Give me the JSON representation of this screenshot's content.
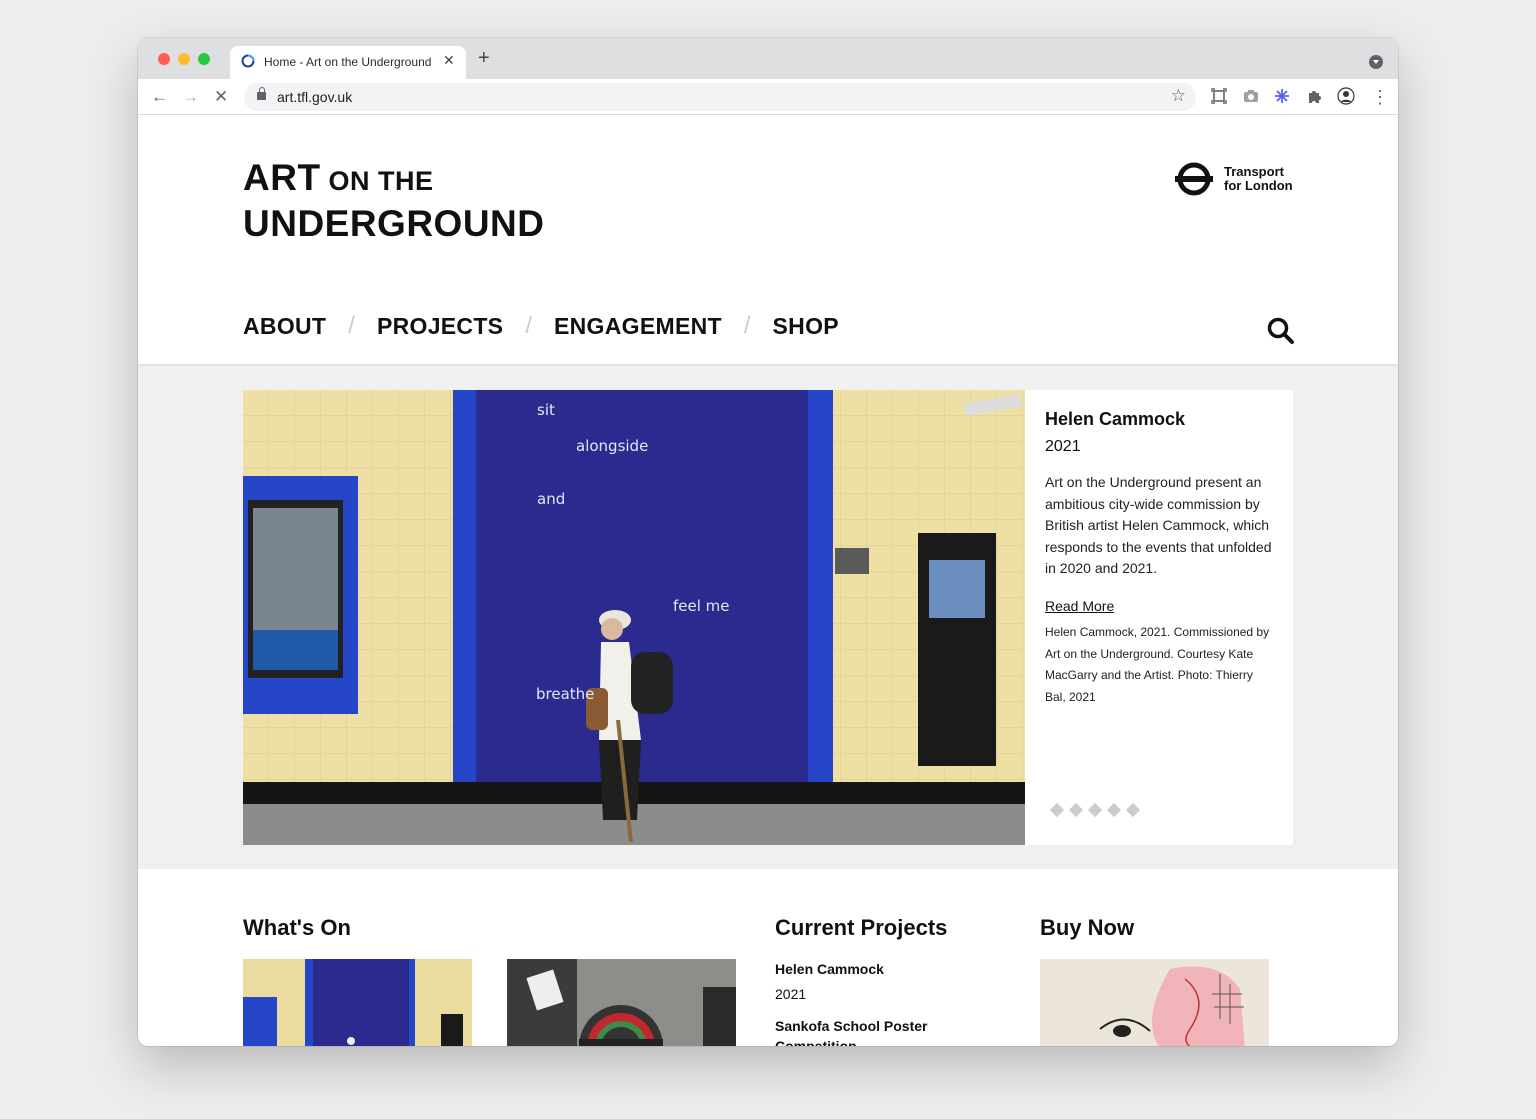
{
  "browser": {
    "tab_title": "Home - Art on the Underground",
    "url": "art.tfl.gov.uk",
    "new_tab": "+",
    "close_tab": "✕"
  },
  "site": {
    "logo": {
      "art": "ART",
      "on_the": " ON THE",
      "underground": "UNDERGROUND"
    },
    "tfl": {
      "line1": "Transport",
      "line2": "for London"
    },
    "nav": [
      "ABOUT",
      "PROJECTS",
      "ENGAGEMENT",
      "SHOP"
    ],
    "hero": {
      "title": "Helen Cammock",
      "year": "2021",
      "description": "Art on the Underground present an ambitious city-wide commission by British artist Helen Cammock, which responds to the events that unfolded in 2020 and 2021.",
      "read_more": "Read More",
      "credit": "Helen Cammock, 2021. Commissioned by Art on the Underground. Courtesy Kate MacGarry and the Artist. Photo: Thierry Bal, 2021",
      "poster_words": [
        "sit",
        "alongside",
        "and",
        "feel me",
        "breathe"
      ],
      "slides": 5
    },
    "sections": {
      "whats_on": "What's On",
      "current_projects": "Current Projects",
      "buy_now": "Buy Now"
    },
    "projects": [
      {
        "title": "Helen Cammock",
        "year": "2021"
      },
      {
        "title": "Sankofa School Poster Competition"
      }
    ],
    "colors": {
      "tfl_blue": "#2f38a8",
      "tile_cream": "#efe3a6",
      "accent_blue": "#2244c8"
    }
  }
}
